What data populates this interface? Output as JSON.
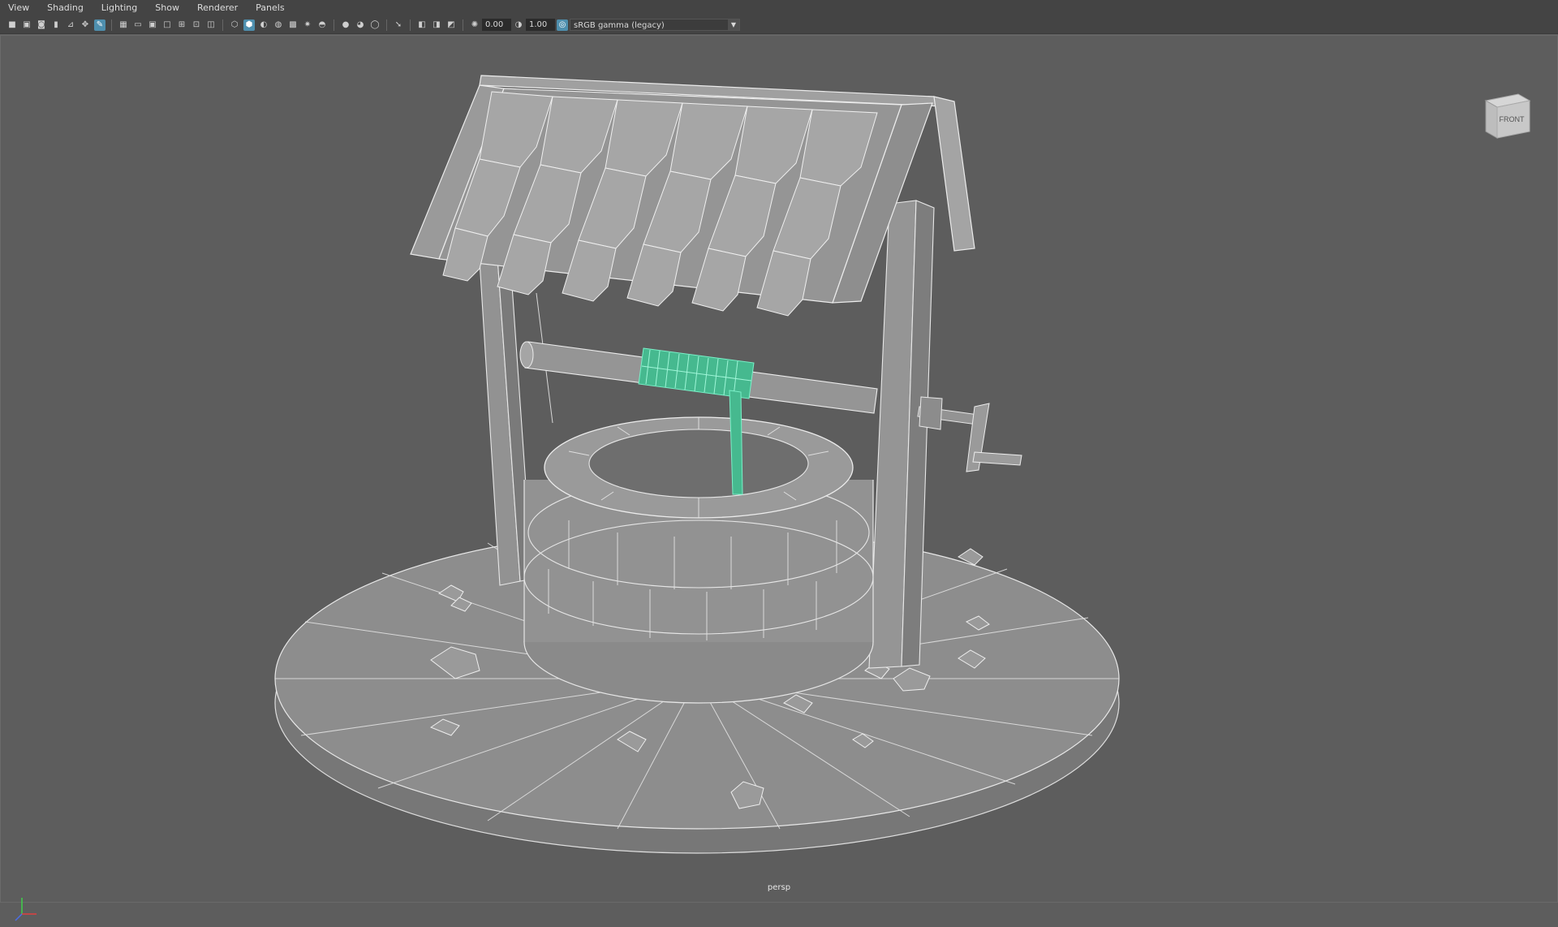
{
  "menubar": {
    "items": [
      "View",
      "Shading",
      "Lighting",
      "Show",
      "Renderer",
      "Panels"
    ]
  },
  "toolbar": {
    "exposure_value": "0.00",
    "gamma_value": "1.00",
    "color_space": "sRGB gamma (legacy)",
    "icons": [
      "camera-select-icon",
      "camera-attributes-icon",
      "bookmark-icon",
      "image-plane-icon",
      "grid-icon",
      "film-gate-icon",
      "resolution-gate-icon",
      "gate-mask-icon",
      "field-chart-icon",
      "safe-action-icon",
      "safe-title-icon",
      "wireframe-icon",
      "smooth-shade-icon",
      "default-material-icon",
      "textured-icon",
      "use-all-lights-icon",
      "shadows-icon",
      "screen-ambient-occlusion-icon",
      "motion-blur-icon",
      "anti-alias-icon",
      "isolate-select-icon",
      "xray-icon",
      "xray-joints-icon",
      "backface-culling-icon",
      "exposure-icon",
      "gamma-icon",
      "color-management-icon"
    ]
  },
  "viewport": {
    "camera_label": "persp",
    "viewcube_label": "FRONT"
  },
  "colors": {
    "background": "#5d5d5d",
    "mesh_fill": "#8c8c8c",
    "mesh_wire": "#e8e8e8",
    "selection": "#3fc9a0",
    "ui_panel": "#444444",
    "active_icon": "#4e8fae"
  }
}
